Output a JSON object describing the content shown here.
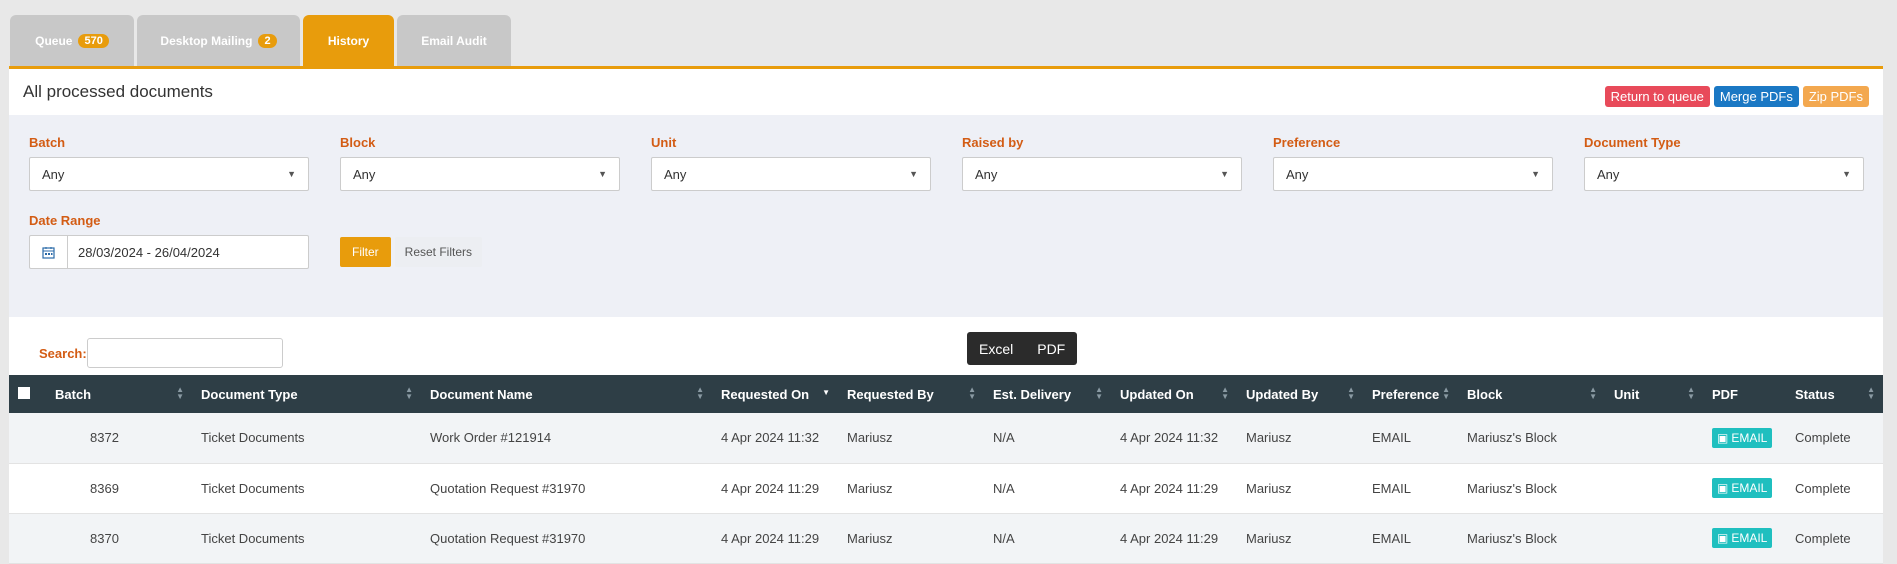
{
  "tabs": [
    {
      "label": "Queue",
      "badge": "570"
    },
    {
      "label": "Desktop Mailing",
      "badge": "2"
    },
    {
      "label": "History",
      "badge": null
    },
    {
      "label": "Email Audit",
      "badge": null
    }
  ],
  "active_tab": "History",
  "panel": {
    "title": "All processed documents",
    "buttons": {
      "return": "Return to queue",
      "merge": "Merge PDFs",
      "zip": "Zip PDFs"
    }
  },
  "filters": {
    "batch": {
      "label": "Batch",
      "value": "Any"
    },
    "block": {
      "label": "Block",
      "value": "Any"
    },
    "unit": {
      "label": "Unit",
      "value": "Any"
    },
    "raised_by": {
      "label": "Raised by",
      "value": "Any"
    },
    "preference": {
      "label": "Preference",
      "value": "Any"
    },
    "doc_type": {
      "label": "Document Type",
      "value": "Any"
    },
    "date_range": {
      "label": "Date Range",
      "value": "28/03/2024 - 26/04/2024"
    },
    "filter_btn": "Filter",
    "reset_btn": "Reset Filters"
  },
  "search": {
    "label": "Search:"
  },
  "export": {
    "excel": "Excel",
    "pdf": "PDF"
  },
  "table": {
    "columns": [
      "Batch",
      "Document Type",
      "Document Name",
      "Requested On",
      "Requested By",
      "Est. Delivery",
      "Updated On",
      "Updated By",
      "Preference",
      "Block",
      "Unit",
      "PDF",
      "Status"
    ],
    "rows": [
      {
        "batch": "8372",
        "doc_type": "Ticket Documents",
        "doc_name": "Work Order #121914",
        "requested_on": "4 Apr 2024 11:32",
        "requested_by": "Mariusz",
        "est_delivery": "N/A",
        "updated_on": "4 Apr 2024 11:32",
        "updated_by": "Mariusz",
        "preference": "EMAIL",
        "block": "Mariusz's Block",
        "unit": "",
        "pdf": "EMAIL",
        "status": "Complete"
      },
      {
        "batch": "8369",
        "doc_type": "Ticket Documents",
        "doc_name": "Quotation Request #31970",
        "requested_on": "4 Apr 2024 11:29",
        "requested_by": "Mariusz",
        "est_delivery": "N/A",
        "updated_on": "4 Apr 2024 11:29",
        "updated_by": "Mariusz",
        "preference": "EMAIL",
        "block": "Mariusz's Block",
        "unit": "",
        "pdf": "EMAIL",
        "status": "Complete"
      },
      {
        "batch": "8370",
        "doc_type": "Ticket Documents",
        "doc_name": "Quotation Request #31970",
        "requested_on": "4 Apr 2024 11:29",
        "requested_by": "Mariusz",
        "est_delivery": "N/A",
        "updated_on": "4 Apr 2024 11:29",
        "updated_by": "Mariusz",
        "preference": "EMAIL",
        "block": "Mariusz's Block",
        "unit": "",
        "pdf": "EMAIL",
        "status": "Complete"
      }
    ]
  },
  "colors": {
    "accent": "#e89c0c",
    "header_bg": "#2e3e46",
    "label": "#d35c14",
    "pdf_btn": "#1fbfbf"
  }
}
